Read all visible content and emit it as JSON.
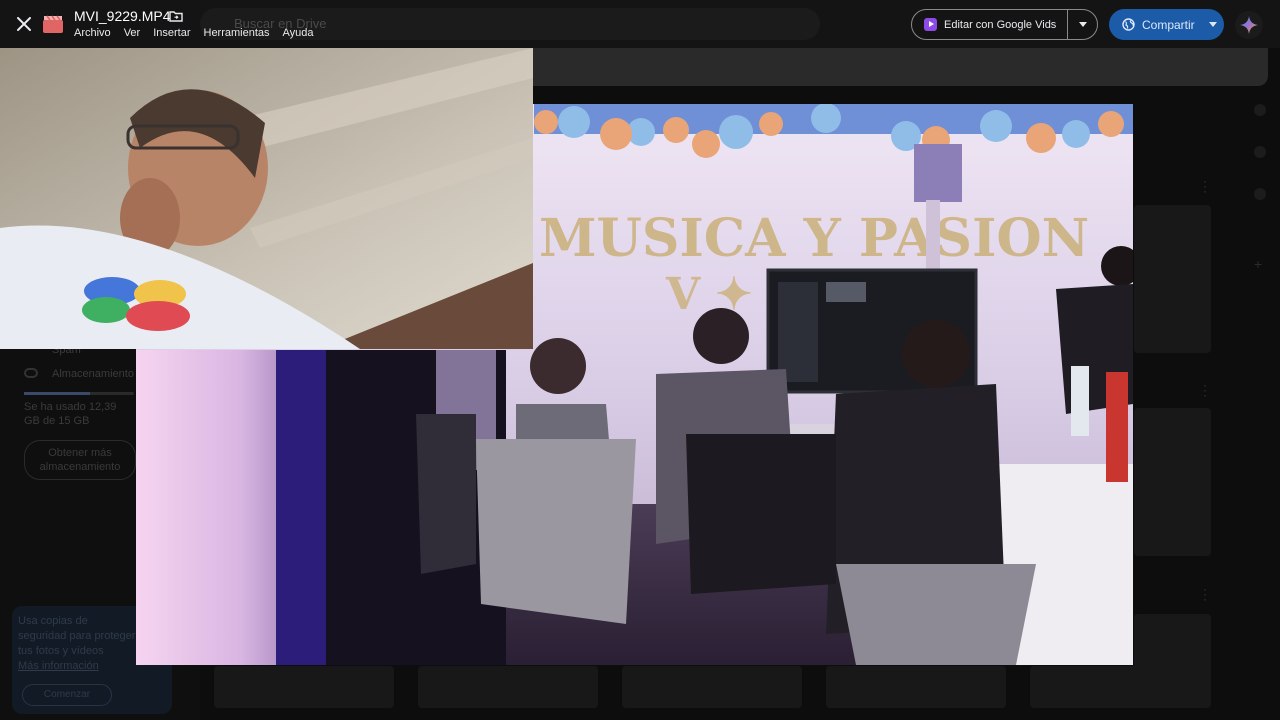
{
  "app": {
    "file_name": "MVI_9229.MP4",
    "menu": [
      "Archivo",
      "Ver",
      "Insertar",
      "Herramientas",
      "Ayuda"
    ]
  },
  "toolbar": {
    "edit_with_vids_label": "Editar con Google Vids",
    "share_label": "Compartir"
  },
  "icons": {
    "close": "close-icon",
    "file": "video-file-icon",
    "folder": "move-to-folder-icon",
    "vids": "google-vids-icon",
    "share": "share-globe-icon",
    "gemini": "gemini-sparkle-icon"
  },
  "colors": {
    "share_button": "#1c5ba8",
    "vids_icon": "#8e4ae8",
    "file_icon": "#e06666"
  },
  "background": {
    "search_placeholder": "Buscar en Drive",
    "sidebar_items": [
      "Spam",
      "Almacenamiento"
    ],
    "storage_text": "Se ha usado 12,39 GB de 15 GB",
    "storage_button": "Obtener más almacenamiento",
    "callout_text": "Usa copias de seguridad para proteger tus fotos y vídeos",
    "callout_link": "Más información",
    "callout_button": "Comenzar"
  },
  "media": {
    "main_video": "party-hall-video",
    "pip_video": "webcam-overlay"
  }
}
